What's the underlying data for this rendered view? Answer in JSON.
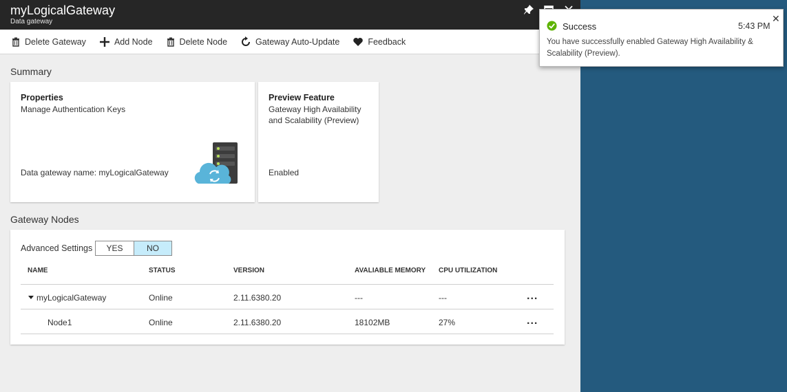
{
  "blade": {
    "title": "myLogicalGateway",
    "subtitle": "Data gateway"
  },
  "toolbar": {
    "delete_gateway": "Delete Gateway",
    "add_node": "Add Node",
    "delete_node": "Delete Node",
    "auto_update": "Gateway Auto-Update",
    "feedback": "Feedback"
  },
  "summary": {
    "label": "Summary",
    "properties": {
      "title": "Properties",
      "link": "Manage Authentication Keys",
      "name_line": "Data gateway name: myLogicalGateway"
    },
    "preview": {
      "title": "Preview Feature",
      "description": "Gateway High Availability and Scalability (Preview)",
      "state": "Enabled"
    }
  },
  "nodes": {
    "label": "Gateway Nodes",
    "advanced_label": "Advanced Settings",
    "toggle": {
      "yes": "YES",
      "no": "NO",
      "selected": "NO"
    },
    "columns": [
      "NAME",
      "STATUS",
      "VERSION",
      "AVALIABLE MEMORY",
      "CPU UTILIZATION"
    ],
    "rows": [
      {
        "name": "myLogicalGateway",
        "status": "Online",
        "version": "2.11.6380.20",
        "memory": "---",
        "cpu": "---",
        "more": "..."
      },
      {
        "name": "Node1",
        "status": "Online",
        "version": "2.11.6380.20",
        "memory": "18102MB",
        "cpu": "27%",
        "more": "..."
      }
    ]
  },
  "toast": {
    "status": "Success",
    "time": "5:43 PM",
    "message": "You have successfully enabled Gateway High Availability & Scalability (Preview).",
    "close": "✕"
  },
  "colors": {
    "titlebar": "#262626",
    "background_right": "#245a7e",
    "toggle_selected": "#c6ecfb",
    "success_green": "#5db300",
    "cloud_blue": "#59b4d9"
  }
}
